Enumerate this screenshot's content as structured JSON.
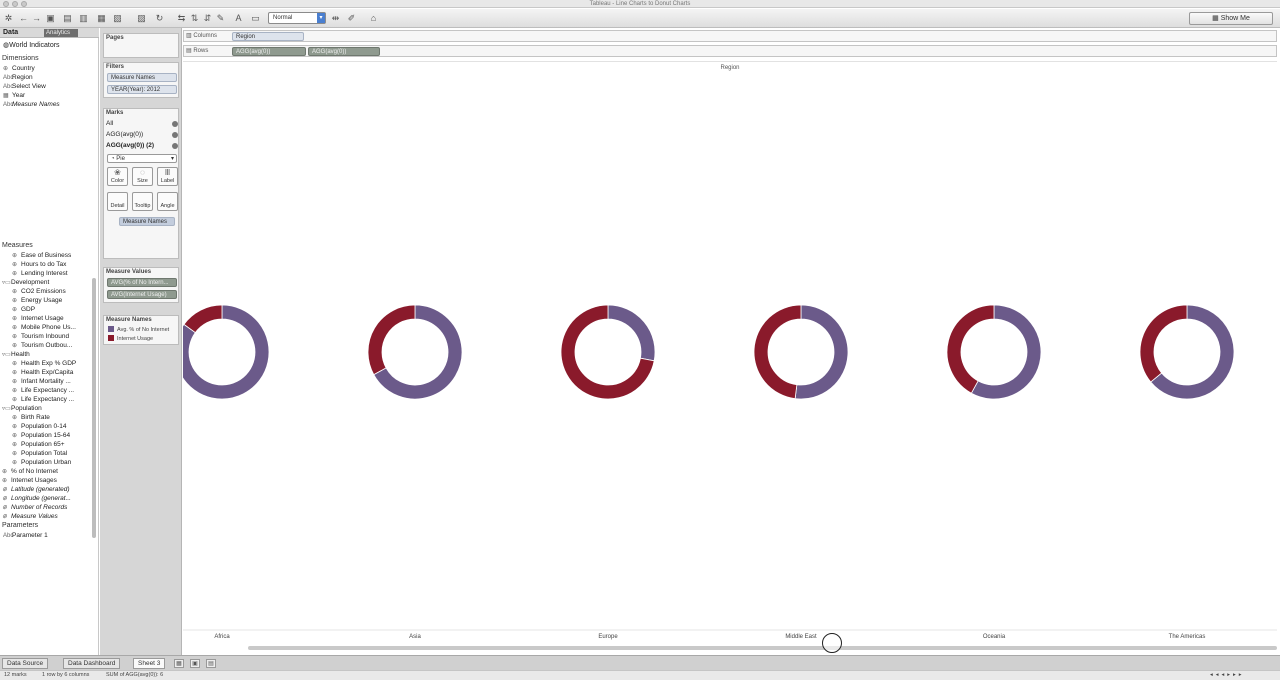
{
  "window": {
    "title": "Tableau - Line Charts to Donut Charts"
  },
  "toolbar": {
    "view_size": "Normal",
    "show_me": "Show Me"
  },
  "datapane": {
    "tab_data": "Data",
    "tab_analytics": "Analytics",
    "datasource": "World Indicators",
    "dimensions_label": "Dimensions",
    "dimensions": [
      "Country",
      "Region",
      "Select View",
      "Year",
      "Measure Names"
    ],
    "measures_label": "Measures",
    "measures": [
      {
        "label": "Ease of Business",
        "indent": 2
      },
      {
        "label": "Hours to do Tax",
        "indent": 2
      },
      {
        "label": "Lending Interest",
        "indent": 2
      },
      {
        "label": "Development",
        "indent": 1
      },
      {
        "label": "CO2 Emissions",
        "indent": 2
      },
      {
        "label": "Energy Usage",
        "indent": 2
      },
      {
        "label": "GDP",
        "indent": 2
      },
      {
        "label": "Internet Usage",
        "indent": 2
      },
      {
        "label": "Mobile Phone Us...",
        "indent": 2
      },
      {
        "label": "Tourism Inbound",
        "indent": 2
      },
      {
        "label": "Tourism Outbou...",
        "indent": 2
      },
      {
        "label": "Health",
        "indent": 1
      },
      {
        "label": "Health Exp % GDP",
        "indent": 2
      },
      {
        "label": "Health Exp/Capita",
        "indent": 2
      },
      {
        "label": "Infant Mortality ...",
        "indent": 2
      },
      {
        "label": "Life Expectancy ...",
        "indent": 2
      },
      {
        "label": "Life Expectancy ...",
        "indent": 2
      },
      {
        "label": "Population",
        "indent": 1
      },
      {
        "label": "Birth Rate",
        "indent": 2
      },
      {
        "label": "Population 0-14",
        "indent": 2
      },
      {
        "label": "Population 15-64",
        "indent": 2
      },
      {
        "label": "Population 65+",
        "indent": 2
      },
      {
        "label": "Population Total",
        "indent": 2
      },
      {
        "label": "Population Urban",
        "indent": 2
      },
      {
        "label": "% of No Internet",
        "indent": 1
      },
      {
        "label": "Internet Usages",
        "indent": 1
      },
      {
        "label": "Latitude (generated)",
        "indent": 1,
        "italic": true
      },
      {
        "label": "Longitude (generat...",
        "indent": 1,
        "italic": true
      },
      {
        "label": "Number of Records",
        "indent": 1,
        "italic": true
      },
      {
        "label": "Measure Values",
        "indent": 1,
        "italic": true
      }
    ],
    "parameters_label": "Parameters",
    "parameters": [
      "Parameter 1"
    ]
  },
  "shelves": {
    "pages_label": "Pages",
    "filters_label": "Filters",
    "filters": [
      "Measure Names",
      "YEAR(Year): 2012"
    ],
    "marks_label": "Marks",
    "marks_rows": [
      "All",
      "AGG(avg(0))",
      "AGG(avg(0)) (2)"
    ],
    "mark_type": "Pie",
    "mark_buttons": [
      {
        "label": "Color",
        "glyph": "❀"
      },
      {
        "label": "Size",
        "glyph": "◌"
      },
      {
        "label": "Label",
        "glyph": "Ⅲ"
      },
      {
        "label": "Detail",
        "glyph": ""
      },
      {
        "label": "Tooltip",
        "glyph": ""
      },
      {
        "label": "Angle",
        "glyph": ""
      }
    ],
    "marks_pill": "Measure Names",
    "measure_values_label": "Measure Values",
    "measure_values": [
      "AVG(% of No Intern...",
      "AVG(Internet Usage)"
    ],
    "legend_title": "Measure Names",
    "legend": [
      {
        "label": "Avg. % of No Internet",
        "color": "#6b5a8a"
      },
      {
        "label": "Internet Usage",
        "color": "#8a1a2b"
      }
    ],
    "columns_label": "Columns",
    "columns_pill": "Region",
    "rows_label": "Rows",
    "rows_pills": [
      "AGG(avg(0))",
      "AGG(avg(0))"
    ]
  },
  "view": {
    "column_header": "Region"
  },
  "chart_data": {
    "type": "pie",
    "title": "",
    "column_header": "Region",
    "categories": [
      "Africa",
      "Asia",
      "Europe",
      "Middle East",
      "Oceania",
      "The Americas"
    ],
    "series": [
      {
        "name": "Avg. % of No Internet",
        "color": "#6b5a8a",
        "values": [
          0.85,
          0.67,
          0.28,
          0.52,
          0.58,
          0.64
        ]
      },
      {
        "name": "Internet Usage",
        "color": "#8a1a2b",
        "values": [
          0.15,
          0.33,
          0.72,
          0.48,
          0.42,
          0.36
        ]
      }
    ],
    "donut": true
  },
  "tabbar": {
    "tabs": [
      "Data Source",
      "Data Dashboard",
      "Sheet 3"
    ],
    "active": 2
  },
  "status": {
    "marks": "12 marks",
    "rows": "1 row by 6 columns",
    "sum": "SUM of AGG(avg(0)): 6"
  }
}
